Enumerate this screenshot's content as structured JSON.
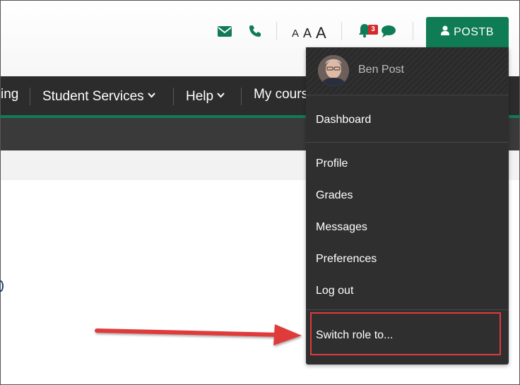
{
  "header": {
    "text_size_labels": [
      "A",
      "A",
      "A"
    ],
    "notification_count": "3",
    "user_button_label": "POSTB",
    "accent_color": "#107c55"
  },
  "nav": {
    "items": [
      {
        "label": "ing"
      },
      {
        "label": "Student Services"
      },
      {
        "label": "Help"
      },
      {
        "label": "My cours"
      }
    ]
  },
  "user_menu": {
    "user_name": "Ben Post",
    "items": [
      {
        "label": "Dashboard"
      },
      {
        "label": "Profile"
      },
      {
        "label": "Grades"
      },
      {
        "label": "Messages"
      },
      {
        "label": "Preferences"
      },
      {
        "label": "Log out"
      },
      {
        "label": "Switch role to..."
      }
    ]
  },
  "annotation": {
    "highlight_color": "#e03b3b",
    "arrow_color": "#e03b3b"
  }
}
